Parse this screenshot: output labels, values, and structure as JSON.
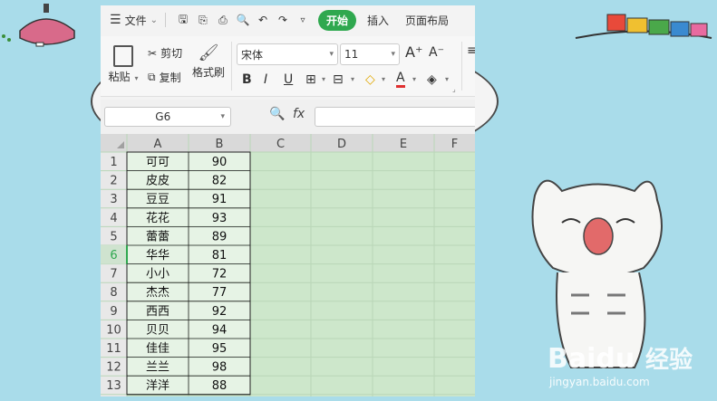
{
  "menu": {
    "file_label": "文件",
    "tabs": [
      "开始",
      "插入",
      "页面布局"
    ],
    "active_tab": "开始"
  },
  "ribbon": {
    "paste_label": "粘贴",
    "cut_label": "剪切",
    "copy_label": "复制",
    "format_painter_label": "格式刷",
    "font_name": "宋体",
    "font_size": "11"
  },
  "formula_bar": {
    "cell_ref": "G6",
    "fx_label": "fx",
    "formula_value": ""
  },
  "sheet": {
    "columns": [
      "A",
      "B",
      "C",
      "D",
      "E",
      "F"
    ],
    "selected_row": 6,
    "rows": [
      {
        "num": "1",
        "name": "可可",
        "score": "90"
      },
      {
        "num": "2",
        "name": "皮皮",
        "score": "82"
      },
      {
        "num": "3",
        "name": "豆豆",
        "score": "91"
      },
      {
        "num": "4",
        "name": "花花",
        "score": "93"
      },
      {
        "num": "5",
        "name": "蕾蕾",
        "score": "89"
      },
      {
        "num": "6",
        "name": "华华",
        "score": "81"
      },
      {
        "num": "7",
        "name": "小小",
        "score": "72"
      },
      {
        "num": "8",
        "name": "杰杰",
        "score": "77"
      },
      {
        "num": "9",
        "name": "西西",
        "score": "92"
      },
      {
        "num": "10",
        "name": "贝贝",
        "score": "94"
      },
      {
        "num": "11",
        "name": "佳佳",
        "score": "95"
      },
      {
        "num": "12",
        "name": "兰兰",
        "score": "98"
      },
      {
        "num": "13",
        "name": "洋洋",
        "score": "88"
      }
    ]
  },
  "watermark": {
    "brand": "Baidu",
    "brand_cn": "经验",
    "url": "jingyan.baidu.com"
  },
  "colors": {
    "accent_green": "#2fa84f",
    "sheet_bg": "#cde7cb",
    "cell_bg": "#e6f3e5",
    "background": "#a9dcea"
  }
}
